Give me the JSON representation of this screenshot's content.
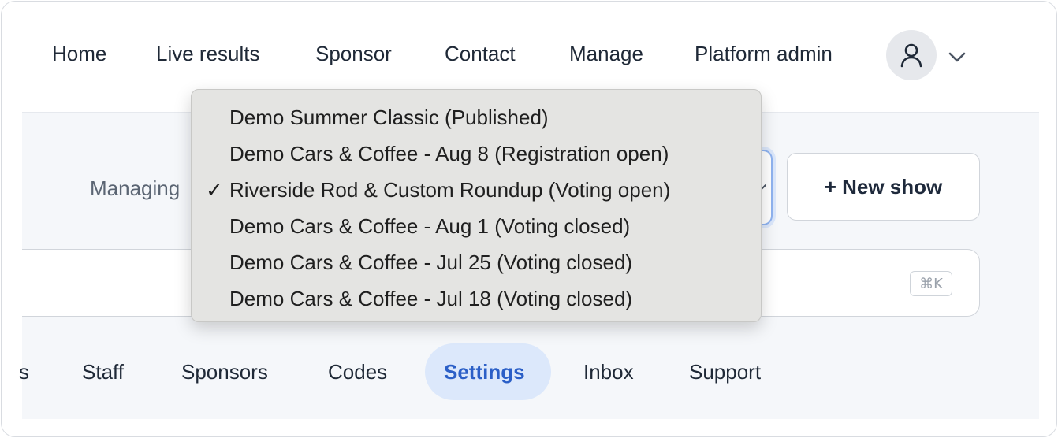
{
  "nav": {
    "items": [
      "Home",
      "Live results",
      "Sponsor",
      "Contact",
      "Manage",
      "Platform admin"
    ],
    "avatar_icon": "user-icon",
    "chevron_icon": "chevron-down-icon"
  },
  "managing": {
    "label": "Managing",
    "selected": "Riverside Rod & Custom Roundup (Voting open)"
  },
  "new_show": {
    "label": "+ New show"
  },
  "search": {
    "shortcut": "⌘K"
  },
  "dropdown": {
    "check_mark": "✓",
    "options": [
      "Demo Summer Classic (Published)",
      "Demo Cars & Coffee - Aug 8 (Registration open)",
      "Riverside Rod & Custom Roundup (Voting open)",
      "Demo Cars & Coffee - Aug 1 (Voting closed)",
      "Demo Cars & Coffee - Jul 25 (Voting closed)",
      "Demo Cars & Coffee - Jul 18 (Voting closed)"
    ],
    "selected_index": 2
  },
  "tabs": {
    "items": [
      "s",
      "Staff",
      "Sponsors",
      "Codes",
      "Settings",
      "Inbox",
      "Support"
    ],
    "active": "Settings"
  },
  "colors": {
    "accent": "#2b5fc7",
    "active_tab_bg": "#dce8fb",
    "band_bg": "#f5f7fa",
    "menu_bg": "#e4e4e2"
  }
}
